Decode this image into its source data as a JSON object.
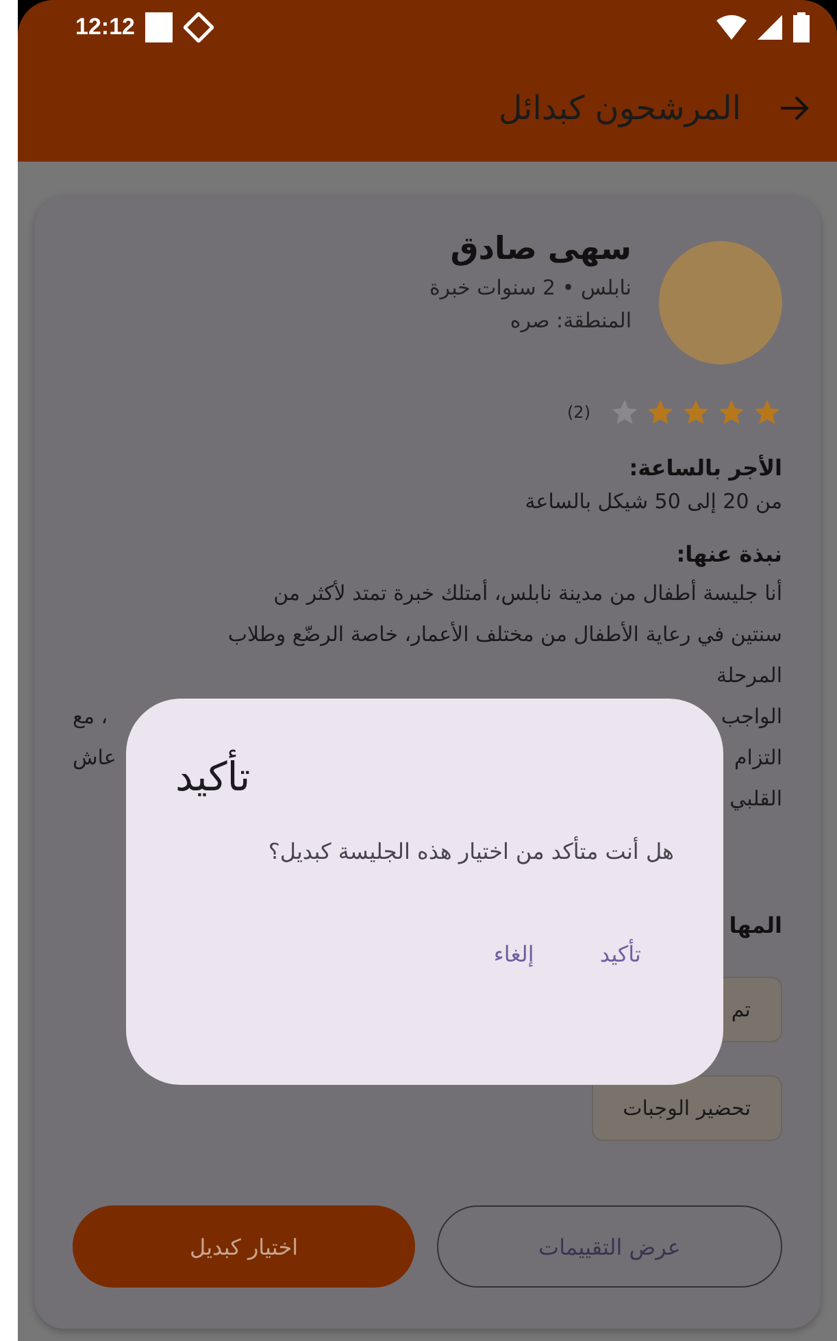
{
  "status_bar": {
    "time": "12:12"
  },
  "app_bar": {
    "title": "المرشحون كبدائل"
  },
  "candidate": {
    "name": "سهى صادق",
    "meta": "نابلس • 2 سنوات خبرة",
    "area": "المنطقة: صره",
    "stars": 4,
    "review_count": "(2)",
    "wage_heading": "الأجر بالساعة:",
    "wage": "من 20 إلى 50 شيكل بالساعة",
    "bio_heading": "نبذة عنها:",
    "bio_lines": [
      {
        "right": "أنا جليسة أطفال من مدينة نابلس، أمتلك خبرة تمتد لأكثر من"
      },
      {
        "right": "سنتين في رعاية الأطفال من مختلف الأعمار، خاصة الرضّع وطلاب"
      },
      {
        "right": "المرحلة"
      },
      {
        "right": "الواجب",
        "left": "، مع"
      },
      {
        "right": "التزام",
        "left": "عاش"
      },
      {
        "right": "القلبي"
      }
    ],
    "skills_heading": "المها",
    "skills": [
      "تم",
      "تحضير الوجبات"
    ],
    "actions": [
      {
        "label": "عرض التقييمات",
        "kind": "outlined"
      },
      {
        "label": "اختيار كبديل",
        "kind": "filled"
      }
    ]
  },
  "dialog": {
    "title": "تأكيد",
    "message": "هل أنت متأكد من اختيار هذه الجليسة كبديل؟",
    "buttons": [
      "تأكيد",
      "إلغاء"
    ]
  }
}
